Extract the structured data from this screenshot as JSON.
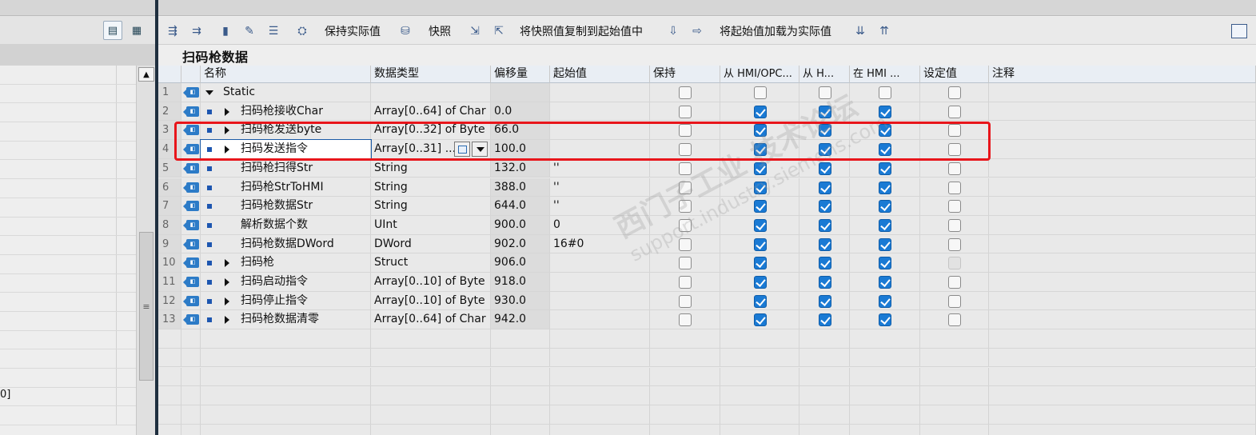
{
  "left_panel": {
    "bottom_value": "0]"
  },
  "toolbar": {
    "keep_actual": "保持实际值",
    "snapshot": "快照",
    "copy_snapshot_to_start": "将快照值复制到起始值中",
    "load_start_as_actual": "将起始值加载为实际值"
  },
  "title": "扫码枪数据",
  "headers": {
    "name": "名称",
    "datatype": "数据类型",
    "offset": "偏移量",
    "start": "起始值",
    "retain": "保持",
    "from_hmi_opc": "从 HMI/OPC...",
    "from_h": "从 H...",
    "in_hmi": "在 HMI ...",
    "setpoint": "设定值",
    "comment": "注释"
  },
  "rows": [
    {
      "n": "1",
      "name": "Static",
      "type": "",
      "offset": "",
      "start": "",
      "retain": false,
      "c1": false,
      "c2": false,
      "c3": false,
      "sp": false
    },
    {
      "n": "2",
      "name": "扫码枪接收Char",
      "type": "Array[0..64] of Char",
      "offset": "0.0",
      "start": "",
      "retain": false,
      "c1": true,
      "c2": true,
      "c3": true,
      "sp": false
    },
    {
      "n": "3",
      "name": "扫码枪发送byte",
      "type": "Array[0..32] of Byte",
      "offset": "66.0",
      "start": "",
      "retain": false,
      "c1": true,
      "c2": true,
      "c3": true,
      "sp": false
    },
    {
      "n": "4",
      "name": "扫码发送指令",
      "type": "Array[0..31] ...",
      "offset": "100.0",
      "start": "",
      "retain": false,
      "c1": true,
      "c2": true,
      "c3": true,
      "sp": false
    },
    {
      "n": "5",
      "name": "扫码枪扫得Str",
      "type": "String",
      "offset": "132.0",
      "start": "''",
      "retain": false,
      "c1": true,
      "c2": true,
      "c3": true,
      "sp": false
    },
    {
      "n": "6",
      "name": "扫码枪StrToHMI",
      "type": "String",
      "offset": "388.0",
      "start": "''",
      "retain": false,
      "c1": true,
      "c2": true,
      "c3": true,
      "sp": false
    },
    {
      "n": "7",
      "name": "扫码枪数据Str",
      "type": "String",
      "offset": "644.0",
      "start": "''",
      "retain": false,
      "c1": true,
      "c2": true,
      "c3": true,
      "sp": false
    },
    {
      "n": "8",
      "name": "解析数据个数",
      "type": "UInt",
      "offset": "900.0",
      "start": "0",
      "retain": false,
      "c1": true,
      "c2": true,
      "c3": true,
      "sp": false
    },
    {
      "n": "9",
      "name": "扫码枪数据DWord",
      "type": "DWord",
      "offset": "902.0",
      "start": "16#0",
      "retain": false,
      "c1": true,
      "c2": true,
      "c3": true,
      "sp": false
    },
    {
      "n": "10",
      "name": "扫码枪",
      "type": "Struct",
      "offset": "906.0",
      "start": "",
      "retain": false,
      "c1": true,
      "c2": true,
      "c3": true,
      "sp": false
    },
    {
      "n": "11",
      "name": "扫码启动指令",
      "type": "Array[0..10] of Byte",
      "offset": "918.0",
      "start": "",
      "retain": false,
      "c1": true,
      "c2": true,
      "c3": true,
      "sp": false
    },
    {
      "n": "12",
      "name": "扫码停止指令",
      "type": "Array[0..10] of Byte",
      "offset": "930.0",
      "start": "",
      "retain": false,
      "c1": true,
      "c2": true,
      "c3": true,
      "sp": false
    },
    {
      "n": "13",
      "name": "扫码枪数据清零",
      "type": "Array[0..64] of Char",
      "offset": "942.0",
      "start": "",
      "retain": false,
      "c1": true,
      "c2": true,
      "c3": true,
      "sp": false
    }
  ],
  "watermark": {
    "line1": "西门子工业 技术论坛",
    "line2": "support.industry.siemens.com"
  }
}
